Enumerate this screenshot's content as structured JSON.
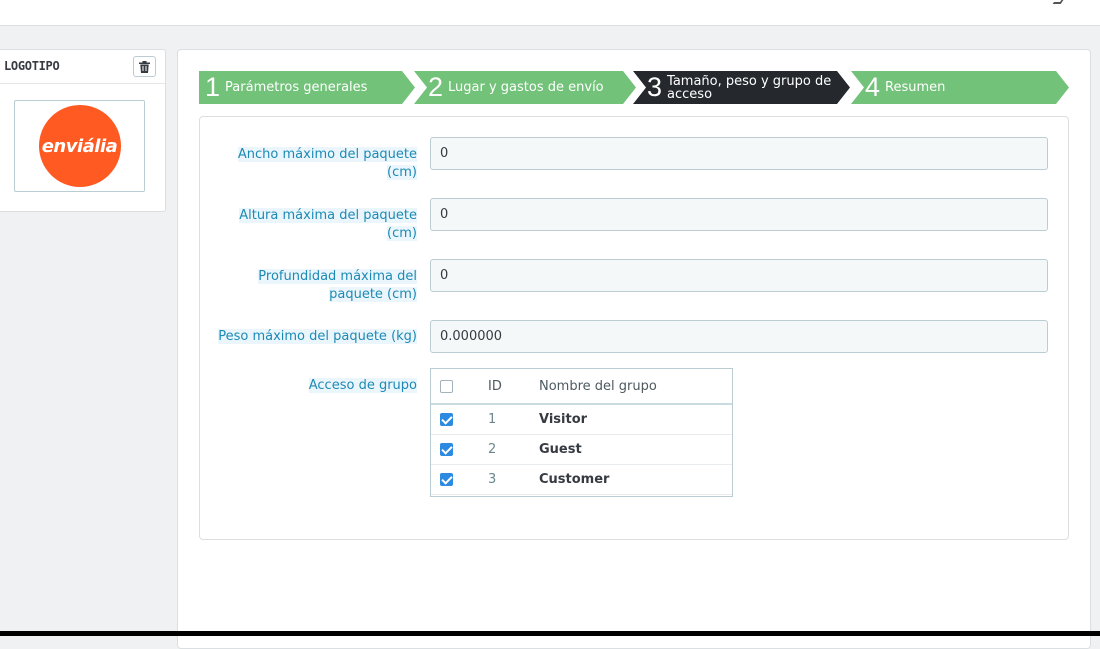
{
  "logo_panel": {
    "title": "LOGOTIPO",
    "logo_text": "enviália",
    "delete_icon": "trash-icon",
    "logo_color": "#ff5a22"
  },
  "wizard": {
    "steps": [
      {
        "num": "1",
        "label": "Parámetros generales",
        "state": "done"
      },
      {
        "num": "2",
        "label": "Lugar y gastos de envío",
        "state": "done"
      },
      {
        "num": "3",
        "label": "Tamaño, peso y grupo de acceso",
        "state": "active"
      },
      {
        "num": "4",
        "label": "Resumen",
        "state": "pending"
      }
    ],
    "done_color": "#72c279",
    "active_color": "#25292e"
  },
  "form": {
    "fields": [
      {
        "label": "Ancho máximo del paquete (cm)",
        "value": "0"
      },
      {
        "label": "Altura máxima del paquete (cm)",
        "value": "0"
      },
      {
        "label": "Profundidad máxima del paquete (cm)",
        "value": "0"
      },
      {
        "label": "Peso máximo del paquete (kg)",
        "value": "0.000000"
      }
    ],
    "group_access": {
      "label": "Acceso de grupo",
      "columns": {
        "id": "ID",
        "name": "Nombre del grupo"
      },
      "select_all_checked": false,
      "rows": [
        {
          "checked": true,
          "id": "1",
          "name": "Visitor"
        },
        {
          "checked": true,
          "id": "2",
          "name": "Guest"
        },
        {
          "checked": true,
          "id": "3",
          "name": "Customer"
        }
      ]
    }
  },
  "colors": {
    "label_blue": "#1d8ab5",
    "label_bg": "#eaf6fb",
    "checkbox_blue": "#2c8ae0"
  }
}
